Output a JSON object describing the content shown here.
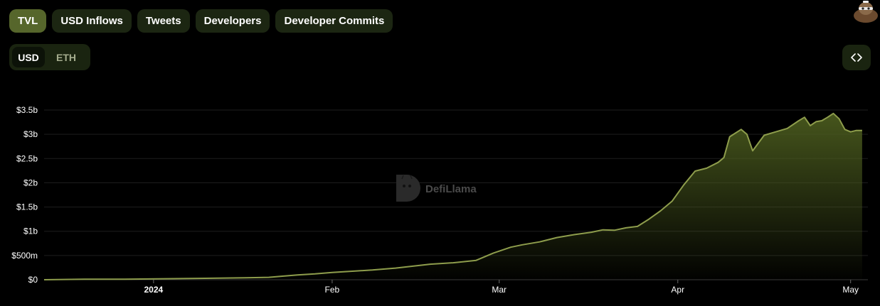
{
  "tabs": [
    {
      "label": "TVL",
      "active": true
    },
    {
      "label": "USD Inflows",
      "active": false
    },
    {
      "label": "Tweets",
      "active": false
    },
    {
      "label": "Developers",
      "active": false
    },
    {
      "label": "Developer Commits",
      "active": false
    }
  ],
  "currency_toggle": {
    "options": [
      "USD",
      "ETH"
    ],
    "selected": "USD"
  },
  "embed_button": {
    "icon": "code-brackets-icon",
    "glyph": "‹›"
  },
  "avatar": {
    "icon": "llama-avatar-icon"
  },
  "watermark": {
    "text": "DefiLlama",
    "icon": "defillama-logo-icon"
  },
  "colors": {
    "accent": "#56662b",
    "line": "#8e9d4c",
    "fill_top": "#4a5a1e",
    "tab_bg": "#1c2612",
    "background": "#000000"
  },
  "chart_data": {
    "type": "area",
    "title": "",
    "xlabel": "",
    "ylabel": "",
    "grid": true,
    "ylim": [
      0,
      3.5
    ],
    "y_unit": "USD billions",
    "y_ticks": [
      {
        "value": 0,
        "label": "$0"
      },
      {
        "value": 0.5,
        "label": "$500m"
      },
      {
        "value": 1,
        "label": "$1b"
      },
      {
        "value": 1.5,
        "label": "$1.5b"
      },
      {
        "value": 2,
        "label": "$2b"
      },
      {
        "value": 2.5,
        "label": "$2.5b"
      },
      {
        "value": 3,
        "label": "$3b"
      },
      {
        "value": 3.5,
        "label": "$3.5b"
      }
    ],
    "xlim": [
      "2023-12-13",
      "2024-05-04"
    ],
    "x_ticks": [
      {
        "date": "2024-01-01",
        "label": "2024",
        "bold": true
      },
      {
        "date": "2024-02-01",
        "label": "Feb",
        "bold": false
      },
      {
        "date": "2024-03-01",
        "label": "Mar",
        "bold": false
      },
      {
        "date": "2024-04-01",
        "label": "Apr",
        "bold": false
      },
      {
        "date": "2024-05-01",
        "label": "May",
        "bold": false
      }
    ],
    "series": [
      {
        "x": [
          "2023-12-13",
          "2023-12-20",
          "2023-12-27",
          "2024-01-03",
          "2024-01-10",
          "2024-01-17",
          "2024-01-21",
          "2024-01-23",
          "2024-01-26",
          "2024-01-29",
          "2024-02-01",
          "2024-02-05",
          "2024-02-08",
          "2024-02-12",
          "2024-02-15",
          "2024-02-18",
          "2024-02-22",
          "2024-02-26",
          "2024-02-29",
          "2024-03-03",
          "2024-03-05",
          "2024-03-08",
          "2024-03-11",
          "2024-03-14",
          "2024-03-17",
          "2024-03-19",
          "2024-03-21",
          "2024-03-23",
          "2024-03-25",
          "2024-03-27",
          "2024-03-29",
          "2024-03-31",
          "2024-04-02",
          "2024-04-04",
          "2024-04-06",
          "2024-04-08",
          "2024-04-09",
          "2024-04-10",
          "2024-04-12",
          "2024-04-13",
          "2024-04-14",
          "2024-04-16",
          "2024-04-18",
          "2024-04-20",
          "2024-04-22",
          "2024-04-23",
          "2024-04-24",
          "2024-04-25",
          "2024-04-26",
          "2024-04-27",
          "2024-04-28",
          "2024-04-29",
          "2024-04-30",
          "2024-05-01",
          "2024-05-02",
          "2024-05-03"
        ],
        "values": [
          0.0,
          0.01,
          0.01,
          0.02,
          0.03,
          0.04,
          0.05,
          0.07,
          0.1,
          0.12,
          0.15,
          0.18,
          0.2,
          0.24,
          0.28,
          0.32,
          0.35,
          0.4,
          0.55,
          0.67,
          0.72,
          0.78,
          0.87,
          0.93,
          0.98,
          1.03,
          1.02,
          1.07,
          1.1,
          1.25,
          1.42,
          1.62,
          1.95,
          2.24,
          2.3,
          2.42,
          2.52,
          2.95,
          3.1,
          3.0,
          2.66,
          2.98,
          3.05,
          3.12,
          3.28,
          3.35,
          3.18,
          3.26,
          3.28,
          3.35,
          3.43,
          3.32,
          3.1,
          3.05,
          3.08,
          3.08
        ]
      }
    ]
  }
}
